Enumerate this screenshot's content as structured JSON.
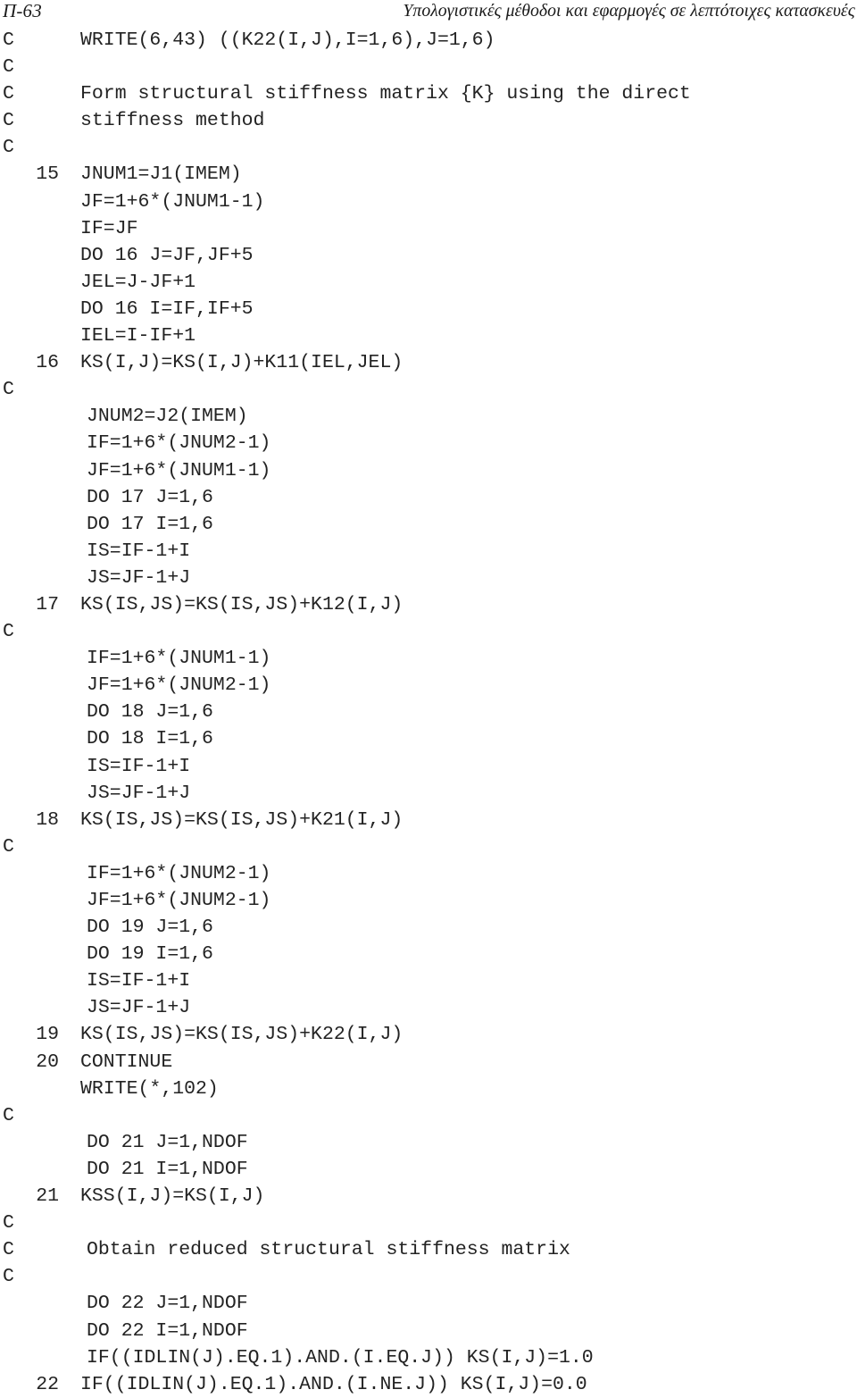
{
  "header": {
    "page_number": "Π-63",
    "running_title": "Υπολογιστικές μέθοδοι και εφαρμογές σε λεπτότοιχες κατασκευές"
  },
  "listing": {
    "language": "FORTRAN",
    "comment_marker": "C",
    "lines": [
      {
        "mark": "C",
        "label": "",
        "code": "WRITE(6,43) ((K22(I,J),I=1,6),J=1,6)",
        "indented": false
      },
      {
        "mark": "C",
        "label": "",
        "code": "",
        "indented": false
      },
      {
        "mark": "C",
        "label": "",
        "code": "Form structural stiffness matrix {K} using the direct",
        "indented": false
      },
      {
        "mark": "C",
        "label": "",
        "code": "stiffness method",
        "indented": false
      },
      {
        "mark": "C",
        "label": "",
        "code": "",
        "indented": false
      },
      {
        "mark": "",
        "label": "15",
        "code": "JNUM1=J1(IMEM)",
        "indented": false
      },
      {
        "mark": "",
        "label": "",
        "code": "JF=1+6*(JNUM1-1)",
        "indented": false
      },
      {
        "mark": "",
        "label": "",
        "code": "IF=JF",
        "indented": false
      },
      {
        "mark": "",
        "label": "",
        "code": "DO 16 J=JF,JF+5",
        "indented": false
      },
      {
        "mark": "",
        "label": "",
        "code": "JEL=J-JF+1",
        "indented": false
      },
      {
        "mark": "",
        "label": "",
        "code": "DO 16 I=IF,IF+5",
        "indented": false
      },
      {
        "mark": "",
        "label": "",
        "code": "IEL=I-IF+1",
        "indented": false
      },
      {
        "mark": "",
        "label": "16",
        "code": "KS(I,J)=KS(I,J)+K11(IEL,JEL)",
        "indented": false
      },
      {
        "mark": "C",
        "label": "",
        "code": "",
        "indented": false
      },
      {
        "mark": "",
        "label": "",
        "code": "JNUM2=J2(IMEM)",
        "indented": true
      },
      {
        "mark": "",
        "label": "",
        "code": "IF=1+6*(JNUM2-1)",
        "indented": true
      },
      {
        "mark": "",
        "label": "",
        "code": "JF=1+6*(JNUM1-1)",
        "indented": true
      },
      {
        "mark": "",
        "label": "",
        "code": "DO 17 J=1,6",
        "indented": true
      },
      {
        "mark": "",
        "label": "",
        "code": "DO 17 I=1,6",
        "indented": true
      },
      {
        "mark": "",
        "label": "",
        "code": "IS=IF-1+I",
        "indented": true
      },
      {
        "mark": "",
        "label": "",
        "code": "JS=JF-1+J",
        "indented": true
      },
      {
        "mark": "",
        "label": "17",
        "code": "KS(IS,JS)=KS(IS,JS)+K12(I,J)",
        "indented": false
      },
      {
        "mark": "C",
        "label": "",
        "code": "",
        "indented": false
      },
      {
        "mark": "",
        "label": "",
        "code": "IF=1+6*(JNUM1-1)",
        "indented": true
      },
      {
        "mark": "",
        "label": "",
        "code": "JF=1+6*(JNUM2-1)",
        "indented": true
      },
      {
        "mark": "",
        "label": "",
        "code": "DO 18 J=1,6",
        "indented": true
      },
      {
        "mark": "",
        "label": "",
        "code": "DO 18 I=1,6",
        "indented": true
      },
      {
        "mark": "",
        "label": "",
        "code": "IS=IF-1+I",
        "indented": true
      },
      {
        "mark": "",
        "label": "",
        "code": "JS=JF-1+J",
        "indented": true
      },
      {
        "mark": "",
        "label": "18",
        "code": "KS(IS,JS)=KS(IS,JS)+K21(I,J)",
        "indented": false
      },
      {
        "mark": "C",
        "label": "",
        "code": "",
        "indented": false
      },
      {
        "mark": "",
        "label": "",
        "code": "IF=1+6*(JNUM2-1)",
        "indented": true
      },
      {
        "mark": "",
        "label": "",
        "code": "JF=1+6*(JNUM2-1)",
        "indented": true
      },
      {
        "mark": "",
        "label": "",
        "code": "DO 19 J=1,6",
        "indented": true
      },
      {
        "mark": "",
        "label": "",
        "code": "DO 19 I=1,6",
        "indented": true
      },
      {
        "mark": "",
        "label": "",
        "code": "IS=IF-1+I",
        "indented": true
      },
      {
        "mark": "",
        "label": "",
        "code": "JS=JF-1+J",
        "indented": true
      },
      {
        "mark": "",
        "label": "19",
        "code": "KS(IS,JS)=KS(IS,JS)+K22(I,J)",
        "indented": false
      },
      {
        "mark": "",
        "label": "20",
        "code": "CONTINUE",
        "indented": false
      },
      {
        "mark": "",
        "label": "",
        "code": "WRITE(*,102)",
        "indented": false
      },
      {
        "mark": "C",
        "label": "",
        "code": "",
        "indented": false
      },
      {
        "mark": "",
        "label": "",
        "code": "DO 21 J=1,NDOF",
        "indented": true
      },
      {
        "mark": "",
        "label": "",
        "code": "DO 21 I=1,NDOF",
        "indented": true
      },
      {
        "mark": "",
        "label": "21",
        "code": "KSS(I,J)=KS(I,J)",
        "indented": false
      },
      {
        "mark": "C",
        "label": "",
        "code": "",
        "indented": false
      },
      {
        "mark": "C",
        "label": "",
        "code": "Obtain reduced structural stiffness matrix",
        "indented": true
      },
      {
        "mark": "C",
        "label": "",
        "code": "",
        "indented": false
      },
      {
        "mark": "",
        "label": "",
        "code": "DO 22 J=1,NDOF",
        "indented": true
      },
      {
        "mark": "",
        "label": "",
        "code": "DO 22 I=1,NDOF",
        "indented": true
      },
      {
        "mark": "",
        "label": "",
        "code": "IF((IDLIN(J).EQ.1).AND.(I.EQ.J)) KS(I,J)=1.0",
        "indented": true
      },
      {
        "mark": "",
        "label": "22",
        "code": "IF((IDLIN(J).EQ.1).AND.(I.NE.J)) KS(I,J)=0.0",
        "indented": false
      }
    ]
  }
}
